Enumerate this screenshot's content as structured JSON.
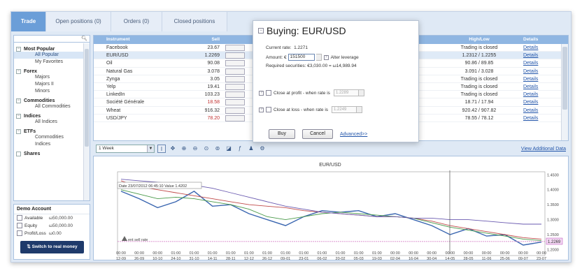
{
  "tabs": [
    "Trade",
    "Open positions (0)",
    "Orders (0)",
    "Closed positions"
  ],
  "sidebar": {
    "groups": [
      {
        "title": "Most Popular",
        "toggle": "−",
        "items": [
          "All Popular",
          "My Favorites"
        ],
        "selected": 0
      },
      {
        "title": "Forex",
        "toggle": "−",
        "items": [
          "Majors",
          "Majors II",
          "Minors"
        ]
      },
      {
        "title": "Commodities",
        "toggle": "−",
        "items": [
          "All Commodities"
        ]
      },
      {
        "title": "Indices",
        "toggle": "−",
        "items": [
          "All Indices"
        ]
      },
      {
        "title": "ETFs",
        "toggle": "−",
        "items": [
          "Commodities",
          "Indices"
        ]
      },
      {
        "title": "Shares",
        "toggle": "",
        "items": []
      }
    ]
  },
  "account": {
    "title": "Demo Account",
    "rows": [
      {
        "label": "Available",
        "value": "ω50,000.00"
      },
      {
        "label": "Equity",
        "value": "ω50,000.00"
      },
      {
        "label": "Profit/Loss",
        "value": "ω0.00"
      }
    ],
    "button": "Switch to real money"
  },
  "grid": {
    "headers": {
      "instrument": "Instrument",
      "sell": "Sell",
      "highlow": "High/Low",
      "details": "Details"
    },
    "rows": [
      {
        "instrument": "Facebook",
        "sell": "23.67",
        "highlow": "Trading is closed",
        "details": "Details"
      },
      {
        "instrument": "EUR/USD",
        "sell": "1.2269",
        "highlow": "1.2312 / 1.2255",
        "details": "Details",
        "selected": true
      },
      {
        "instrument": "Oil",
        "sell": "90.08",
        "highlow": "90.86 / 89.85",
        "details": "Details"
      },
      {
        "instrument": "Natural Gas",
        "sell": "3.078",
        "highlow": "3.091 / 3.028",
        "details": "Details"
      },
      {
        "instrument": "Zynga",
        "sell": "3.05",
        "highlow": "Trading is closed",
        "details": "Details"
      },
      {
        "instrument": "Yelp",
        "sell": "19.41",
        "highlow": "Trading is closed",
        "details": "Details"
      },
      {
        "instrument": "LinkedIn",
        "sell": "103.23",
        "highlow": "Trading is closed",
        "details": "Details"
      },
      {
        "instrument": "Société Générale",
        "sell": "18.58",
        "neg": true,
        "highlow": "18.71 / 17.94",
        "details": "Details"
      },
      {
        "instrument": "Wheat",
        "sell": "916.32",
        "highlow": "920.42 / 907.82",
        "details": "Details"
      },
      {
        "instrument": "USD/JPY",
        "sell": "78.20",
        "neg": true,
        "highlow": "78.55 / 78.12",
        "details": "Details"
      }
    ],
    "partial_row": {
      "sell_btn": "Sell",
      "sell_val": "78.22",
      "buy_btn": "Buy",
      "change": "-0.13%"
    }
  },
  "chart_toolbar": {
    "period": "1 Week",
    "link": "View Additional Data"
  },
  "chart": {
    "title": "EUR/USD",
    "tooltip": "Date 23/07/2012 06:45:10 Value 1.4202",
    "sell_rate_label": "ent sell rate",
    "current_value": "1.2269",
    "y_ticks": [
      "1.4500",
      "1.4000",
      "1.3500",
      "1.3000",
      "1.2500",
      "1.2000"
    ],
    "x_ticks": [
      [
        "00:00",
        "12-09"
      ],
      [
        "00:00",
        "26-09"
      ],
      [
        "00:00",
        "10-10"
      ],
      [
        "01:00",
        "24-10"
      ],
      [
        "01:00",
        "31-10"
      ],
      [
        "01:00",
        "14-11"
      ],
      [
        "01:00",
        "28-11"
      ],
      [
        "01:00",
        "12-12"
      ],
      [
        "01:00",
        "26-12"
      ],
      [
        "01:00",
        "09-01"
      ],
      [
        "01:00",
        "23-01"
      ],
      [
        "01:00",
        "06-02"
      ],
      [
        "01:00",
        "20-02"
      ],
      [
        "01:00",
        "05-03"
      ],
      [
        "01:00",
        "19-03"
      ],
      [
        "00:00",
        "02-04"
      ],
      [
        "00:00",
        "16-04"
      ],
      [
        "00:00",
        "30-04"
      ],
      [
        "00:00",
        "14-05"
      ],
      [
        "00:00",
        "28-05"
      ],
      [
        "00:00",
        "11-06"
      ],
      [
        "00:00",
        "25-06"
      ],
      [
        "00:00",
        "09-07"
      ],
      [
        "00:00",
        "23-07"
      ]
    ],
    "colors": {
      "price": "#3a66b0",
      "ma1": "#c04a4a",
      "ma2": "#4a9a4a",
      "ma3": "#6a5ab0",
      "sell_line": "#d070c0"
    }
  },
  "dialog": {
    "title": "Buying: EUR/USD",
    "current_rate_label": "Current rate:",
    "current_rate": "1.2271",
    "amount_label": "Amount: €",
    "amount": "151500",
    "alter_leverage": "Alter leverage",
    "required_label": "Required securities:",
    "required_value": "€3,030.00 = ω14,989.94",
    "close_profit_label": "Close at profit - when rate is",
    "close_profit_value": "1.2289",
    "close_loss_label": "Close at loss - when rate is",
    "close_loss_value": "1.2249",
    "buy": "Buy",
    "cancel": "Cancel",
    "advanced": "Advanced>>"
  }
}
